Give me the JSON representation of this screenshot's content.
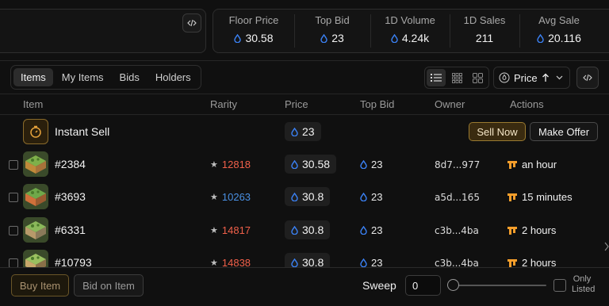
{
  "stats": [
    {
      "label": "Floor Price",
      "value": "30.58",
      "icon": "drop-icon"
    },
    {
      "label": "Top Bid",
      "value": "23",
      "icon": "drop-icon"
    },
    {
      "label": "1D Volume",
      "value": "4.24k",
      "icon": "drop-icon"
    },
    {
      "label": "1D Sales",
      "value": "211"
    },
    {
      "label": "Avg Sale",
      "value": "20.116",
      "icon": "drop-icon"
    }
  ],
  "tabs": [
    {
      "label": "Items",
      "active": true
    },
    {
      "label": "My Items"
    },
    {
      "label": "Bids"
    },
    {
      "label": "Holders"
    }
  ],
  "toolbar": {
    "sort_label": "Price",
    "view_modes": [
      "list-icon",
      "grid-small-icon",
      "grid-large-icon"
    ],
    "active_view": "list-icon"
  },
  "columns": [
    "Item",
    "Rarity",
    "Price",
    "Top Bid",
    "Owner",
    "Actions"
  ],
  "instant_sell": {
    "label": "Instant Sell",
    "price": "23",
    "sell_now_label": "Sell Now",
    "make_offer_label": "Make Offer"
  },
  "items": [
    {
      "name": "#2384",
      "rarity": "12818",
      "rarity_color": "#f0604a",
      "price": "30.58",
      "top_bid": "23",
      "owner": "8d7...977",
      "listed": "an hour"
    },
    {
      "name": "#3693",
      "rarity": "10263",
      "rarity_color": "#4a90e2",
      "price": "30.8",
      "top_bid": "23",
      "owner": "a5d...165",
      "listed": "15 minutes"
    },
    {
      "name": "#6331",
      "rarity": "14817",
      "rarity_color": "#f0604a",
      "price": "30.8",
      "top_bid": "23",
      "owner": "c3b...4ba",
      "listed": "2 hours"
    },
    {
      "name": "#10793",
      "rarity": "14838",
      "rarity_color": "#f0604a",
      "price": "30.8",
      "top_bid": "23",
      "owner": "c3b...4ba",
      "listed": "2 hours"
    }
  ],
  "footer": {
    "buy_label": "Buy Item",
    "bid_label": "Bid on Item",
    "sweep_label": "Sweep",
    "sweep_value": "0",
    "only_listed_label_1": "Only",
    "only_listed_label_2": "Listed"
  },
  "colors": {
    "accent_gold": "#9a7a30",
    "drop_blue": "#3b82f6",
    "rarity_red": "#f0604a",
    "rarity_blue": "#4a90e2"
  }
}
